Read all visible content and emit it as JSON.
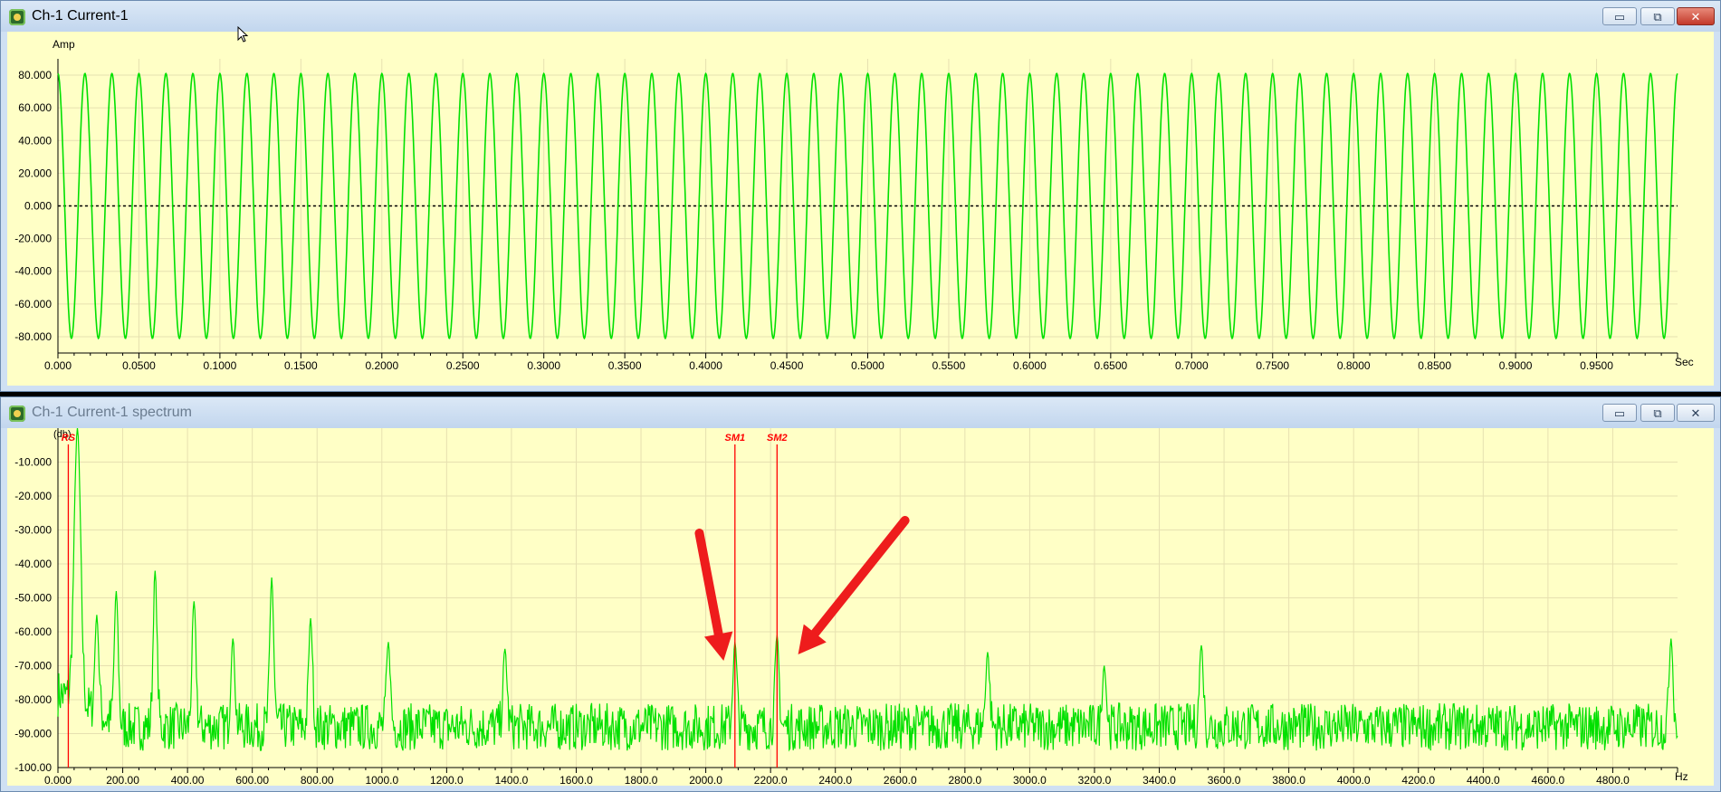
{
  "window1": {
    "title": "Ch-1 Current-1",
    "controls": {
      "minimize": "▭",
      "restore": "⧉",
      "close": "✕"
    },
    "chart_data": {
      "type": "line",
      "title": "",
      "ylabel": "Amp",
      "xlabel": "Sec",
      "xlim": [
        0.0,
        1.0
      ],
      "ylim": [
        -90.0,
        90.0
      ],
      "yticks": [
        "80.000",
        "60.000",
        "40.000",
        "20.000",
        "0.000",
        "-20.000",
        "-40.000",
        "-60.000",
        "-80.000"
      ],
      "xticks": [
        "0.000",
        "0.0500",
        "0.1000",
        "0.1500",
        "0.2000",
        "0.2500",
        "0.3000",
        "0.3500",
        "0.4000",
        "0.4500",
        "0.5000",
        "0.5500",
        "0.6000",
        "0.6500",
        "0.7000",
        "0.7500",
        "0.8000",
        "0.8500",
        "0.9000",
        "0.9500"
      ],
      "series": [
        {
          "amplitude": 81.0,
          "frequency_hz": 60,
          "color": "#00e000"
        }
      ],
      "zero_line": true,
      "grid": true
    }
  },
  "window2": {
    "title": "Ch-1 Current-1 spectrum",
    "controls": {
      "minimize": "▭",
      "restore": "⧉",
      "close": "✕"
    },
    "chart_data": {
      "type": "line",
      "title": "",
      "ylabel": "(db)",
      "xlabel": "Hz",
      "xlim": [
        0.0,
        5000.0
      ],
      "ylim": [
        -100.0,
        0.0
      ],
      "yticks": [
        "-10.000",
        "-20.000",
        "-30.000",
        "-40.000",
        "-50.000",
        "-60.000",
        "-70.000",
        "-80.000",
        "-90.000",
        "-100.00"
      ],
      "xticks": [
        "0.000",
        "200.00",
        "400.00",
        "600.00",
        "800.00",
        "1000.0",
        "1200.0",
        "1400.0",
        "1600.0",
        "1800.0",
        "2000.0",
        "2200.0",
        "2400.0",
        "2600.0",
        "2800.0",
        "3000.0",
        "3200.0",
        "3400.0",
        "3600.0",
        "3800.0",
        "4000.0",
        "4200.0",
        "4400.0",
        "4600.0",
        "4800.0"
      ],
      "noise_floor_db": -88,
      "peaks": [
        {
          "hz": 60,
          "db": 0
        },
        {
          "hz": 120,
          "db": -55
        },
        {
          "hz": 180,
          "db": -48
        },
        {
          "hz": 300,
          "db": -42
        },
        {
          "hz": 420,
          "db": -51
        },
        {
          "hz": 540,
          "db": -62
        },
        {
          "hz": 660,
          "db": -44
        },
        {
          "hz": 780,
          "db": -56
        },
        {
          "hz": 1020,
          "db": -63
        },
        {
          "hz": 1380,
          "db": -65
        },
        {
          "hz": 2090,
          "db": -63
        },
        {
          "hz": 2220,
          "db": -61
        },
        {
          "hz": 2870,
          "db": -66
        },
        {
          "hz": 3230,
          "db": -70
        },
        {
          "hz": 3530,
          "db": -64
        },
        {
          "hz": 4980,
          "db": -62
        }
      ],
      "markers": [
        {
          "label": "RS",
          "hz": 32
        },
        {
          "label": "SM1",
          "hz": 2090
        },
        {
          "label": "SM2",
          "hz": 2220
        }
      ],
      "color": "#00e000",
      "grid": true
    }
  }
}
